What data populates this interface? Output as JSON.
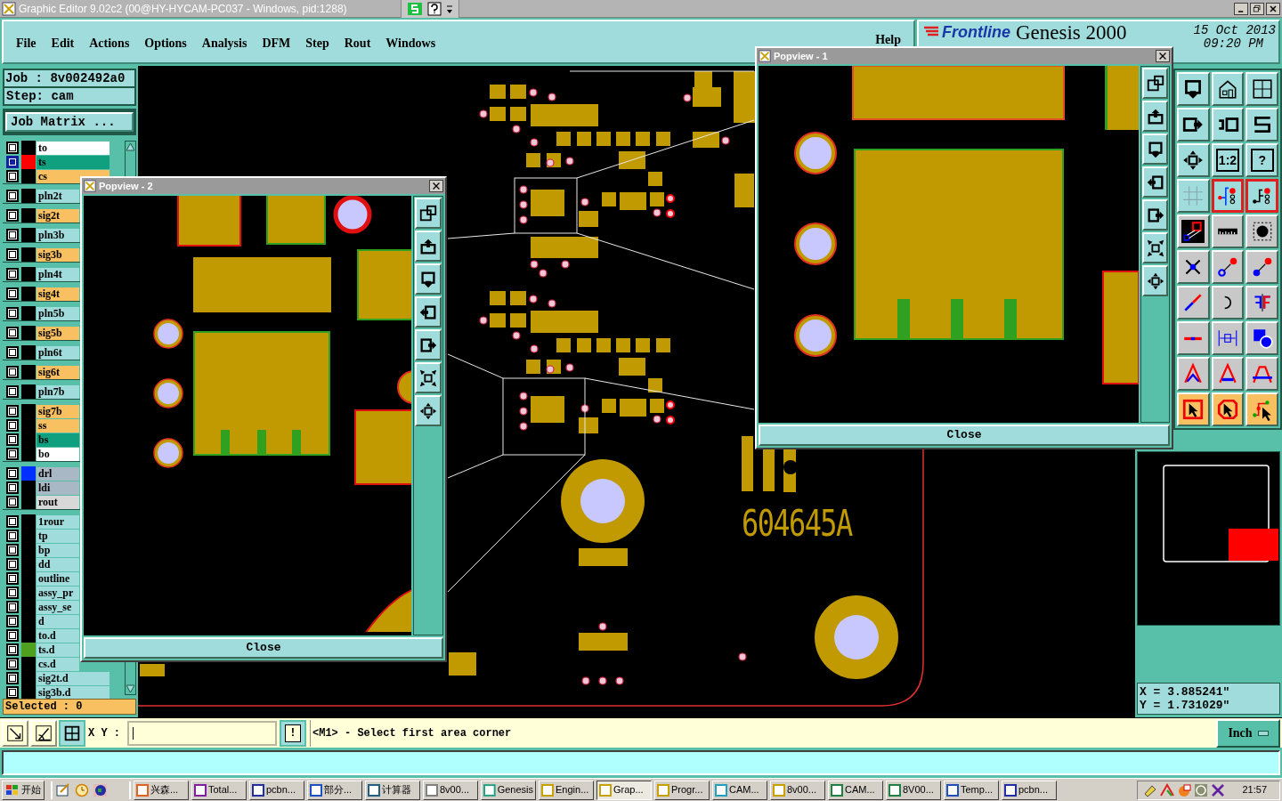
{
  "window": {
    "title": "Graphic Editor 9.02c2 (00@HY-HYCAM-PC037 - Windows, pid:1288)"
  },
  "menu": [
    {
      "label": "File"
    },
    {
      "label": "Edit"
    },
    {
      "label": "Actions"
    },
    {
      "label": "Options"
    },
    {
      "label": "Analysis"
    },
    {
      "label": "DFM"
    },
    {
      "label": "Step"
    },
    {
      "label": "Rout"
    },
    {
      "label": "Windows"
    },
    {
      "label": "Help"
    }
  ],
  "header": {
    "logo": "Frontline",
    "product": "Genesis 2000",
    "date": "15 Oct 2013",
    "time": "09:20 PM"
  },
  "job": {
    "job": "Job : 8v002492a0",
    "step": "Step: cam",
    "matrix_button": "Job Matrix ..."
  },
  "layer_groups": [
    {
      "layers": [
        {
          "name": "to",
          "kind": "silk",
          "selected": false
        },
        {
          "name": "ts",
          "kind": "mask",
          "selected": true,
          "color": "#ff0000"
        },
        {
          "name": "cs",
          "kind": "signal",
          "selected": false
        }
      ]
    },
    {
      "layers": [
        {
          "name": "pln2t",
          "kind": "plane",
          "selected": false
        }
      ]
    },
    {
      "layers": [
        {
          "name": "sig2t",
          "kind": "signal",
          "selected": false
        }
      ]
    },
    {
      "layers": [
        {
          "name": "pln3b",
          "kind": "plane",
          "selected": false
        }
      ]
    },
    {
      "layers": [
        {
          "name": "sig3b",
          "kind": "signal",
          "selected": false
        }
      ]
    },
    {
      "layers": [
        {
          "name": "pln4t",
          "kind": "plane",
          "selected": false
        }
      ]
    },
    {
      "layers": [
        {
          "name": "sig4t",
          "kind": "signal",
          "selected": false
        }
      ]
    },
    {
      "layers": [
        {
          "name": "pln5b",
          "kind": "plane",
          "selected": false
        }
      ]
    },
    {
      "layers": [
        {
          "name": "sig5b",
          "kind": "signal",
          "selected": false
        }
      ]
    },
    {
      "layers": [
        {
          "name": "pln6t",
          "kind": "plane",
          "selected": false
        }
      ]
    },
    {
      "layers": [
        {
          "name": "sig6t",
          "kind": "signal",
          "selected": false
        }
      ]
    },
    {
      "layers": [
        {
          "name": "pln7b",
          "kind": "plane",
          "selected": false
        }
      ]
    },
    {
      "layers": [
        {
          "name": "sig7b",
          "kind": "signal",
          "selected": false
        },
        {
          "name": "ss",
          "kind": "signal",
          "selected": false
        },
        {
          "name": "bs",
          "kind": "mask",
          "selected": false
        },
        {
          "name": "bo",
          "kind": "silk",
          "selected": false
        }
      ]
    },
    {
      "layers": [
        {
          "name": "drl",
          "kind": "drill",
          "selected": false,
          "color": "#0030ff"
        },
        {
          "name": "ldi",
          "kind": "drill",
          "selected": false
        },
        {
          "name": "rout",
          "kind": "rout",
          "selected": false
        }
      ]
    },
    {
      "layers": [
        {
          "name": "1rour",
          "kind": "document",
          "selected": false
        },
        {
          "name": "tp",
          "kind": "document",
          "selected": false
        },
        {
          "name": "bp",
          "kind": "document",
          "selected": false
        },
        {
          "name": "dd",
          "kind": "document",
          "selected": false
        },
        {
          "name": "outline",
          "kind": "document",
          "selected": false
        },
        {
          "name": "assy_pr",
          "kind": "document",
          "selected": false
        },
        {
          "name": "assy_se",
          "kind": "document",
          "selected": false
        },
        {
          "name": "d",
          "kind": "document",
          "selected": false
        },
        {
          "name": "to.d",
          "kind": "document",
          "selected": false
        },
        {
          "name": "ts.d",
          "kind": "document",
          "selected": false,
          "color": "#50a020"
        },
        {
          "name": "cs.d",
          "kind": "document",
          "selected": false
        },
        {
          "name": "sig2t.d",
          "kind": "document",
          "selected": false
        },
        {
          "name": "sig3b.d",
          "kind": "document",
          "selected": false
        }
      ]
    }
  ],
  "selected_count": "Selected : 0",
  "canvas": {
    "silkscreen": "604645A"
  },
  "popviews": [
    {
      "title": "Popview - 2",
      "close": "Close"
    },
    {
      "title": "Popview - 1",
      "close": "Close"
    }
  ],
  "tools": [
    {
      "kind": "view-down",
      "on": false
    },
    {
      "kind": "home",
      "on": false
    },
    {
      "kind": "xy-grid",
      "on": false
    },
    {
      "kind": "box-right",
      "on": false
    },
    {
      "kind": "undo-box",
      "on": false
    },
    {
      "kind": "snake",
      "on": false
    },
    {
      "kind": "pan",
      "on": false
    },
    {
      "kind": "scale",
      "on": false,
      "label": "1:2"
    },
    {
      "kind": "help",
      "on": false,
      "label": "?"
    },
    {
      "kind": "grid",
      "on": false
    },
    {
      "kind": "net",
      "on": true
    },
    {
      "kind": "net2",
      "on": true
    },
    {
      "kind": "measure",
      "on": false
    },
    {
      "kind": "ruler",
      "on": false
    },
    {
      "kind": "dot",
      "on": false
    },
    {
      "kind": "cross",
      "on": false
    },
    {
      "kind": "hollow-arrow",
      "on": false
    },
    {
      "kind": "solid-arrow",
      "on": false
    },
    {
      "kind": "slash",
      "on": false
    },
    {
      "kind": "rotate",
      "on": false
    },
    {
      "kind": "mirror",
      "on": false
    },
    {
      "kind": "hline",
      "on": false
    },
    {
      "kind": "dimension",
      "on": false
    },
    {
      "kind": "shapes",
      "on": false
    },
    {
      "kind": "frame1",
      "on": false
    },
    {
      "kind": "frame2",
      "on": false
    },
    {
      "kind": "frame3",
      "on": false
    },
    {
      "kind": "select-box",
      "on": false
    },
    {
      "kind": "select-oct",
      "on": false
    },
    {
      "kind": "select-net",
      "on": false
    }
  ],
  "coords": {
    "x": "X = 3.885241\"",
    "y": "Y = 1.731029\""
  },
  "command": {
    "xy_label": "X Y :",
    "bang": "!",
    "message": "<M1> - Select first area corner",
    "units": "Inch"
  },
  "taskbar": {
    "start": "开始",
    "tasks": [
      {
        "label": "兴森...",
        "selected": false
      },
      {
        "label": "Total...",
        "selected": false
      },
      {
        "label": "pcbn...",
        "selected": false
      },
      {
        "label": "部分...",
        "selected": false
      },
      {
        "label": "计算器",
        "selected": false
      },
      {
        "label": "8v00...",
        "selected": false
      },
      {
        "label": "Genesis",
        "selected": false
      },
      {
        "label": "Engin...",
        "selected": false
      },
      {
        "label": "Grap...",
        "selected": true
      },
      {
        "label": "Progr...",
        "selected": false
      },
      {
        "label": "CAM...",
        "selected": false
      },
      {
        "label": "8v00...",
        "selected": false
      },
      {
        "label": "CAM...",
        "selected": false
      },
      {
        "label": "8V00...",
        "selected": false
      },
      {
        "label": "Temp...",
        "selected": false
      },
      {
        "label": "pcbn...",
        "selected": false
      }
    ],
    "clock": "21:57"
  }
}
